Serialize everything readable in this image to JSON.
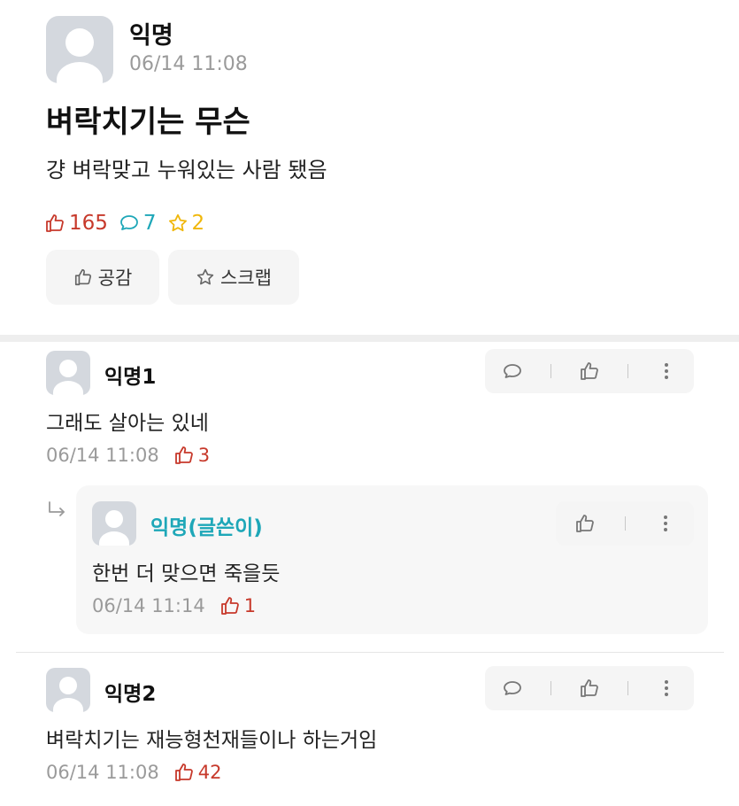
{
  "post": {
    "author": "익명",
    "time": "06/14 11:08",
    "title": "벼락치기는 무슨",
    "body": "걍 벼락맞고 누워있는 사람 됐음",
    "like_count": "165",
    "comment_count": "7",
    "scrap_count": "2",
    "like_button_label": "공감",
    "scrap_button_label": "스크랩"
  },
  "comments": [
    {
      "author": "익명1",
      "text": "그래도 살아는 있네",
      "time": "06/14 11:08",
      "likes": "3"
    },
    {
      "author": "익명2",
      "text": "벼락치기는 재능형천재들이나 하는거임",
      "time": "06/14 11:08",
      "likes": "42"
    }
  ],
  "reply": {
    "author": "익명(글쓴이)",
    "text": "한번 더 맞으면 죽을듯",
    "time": "06/14 11:14",
    "likes": "1"
  },
  "colors": {
    "like": "#c7392b",
    "comment": "#1ea7b8",
    "scrap": "#f0b70a",
    "op_name": "#1ea7b8"
  }
}
